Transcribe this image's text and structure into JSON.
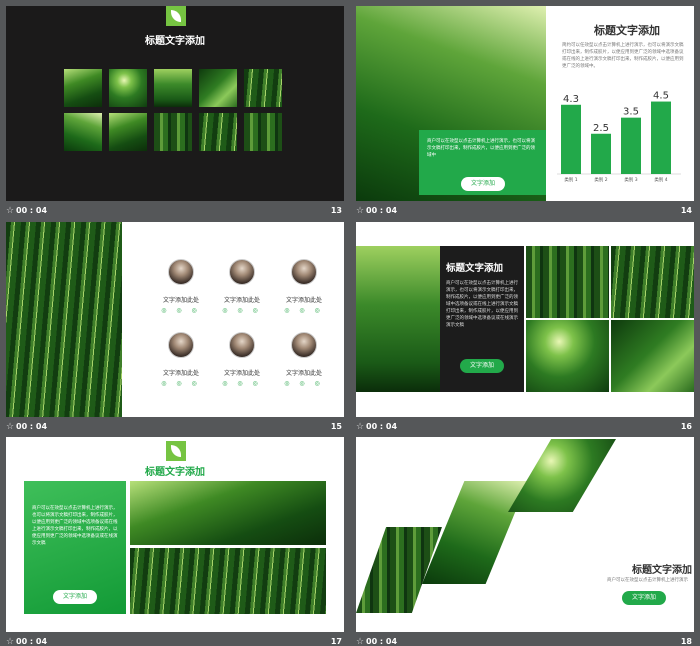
{
  "slides": [
    {
      "title": "标题文字添加",
      "time": "00 : 04",
      "number": "13"
    },
    {
      "title": "标题文字添加",
      "text": "简约可以任效型以点击计算机上进行演示，也可以将演示文稿打印出来，制作成胶片，以便应用到更广泛的领域中选项备议或在线的上进行演示文稿打印出来，制作成胶片，以便应用到更广泛的领域中。",
      "box_text": "商户可以在效型以点击计算机上进行演示，也可以将演示文稿打印出来，制作成胶片，以便应用到更广泛的领域中",
      "button": "文字添加",
      "time": "00 : 04",
      "number": "14",
      "chart_data": {
        "type": "bar",
        "categories": [
          "类别 1",
          "类别 2",
          "类别 3",
          "类别 4"
        ],
        "values": [
          4.3,
          2.5,
          3.5,
          4.5
        ],
        "ylim": [
          0,
          5
        ],
        "bar_color": "#22a94a"
      }
    },
    {
      "people": [
        {
          "name": "文字添加此处",
          "social": "◎ ◎ ◎"
        },
        {
          "name": "文字添加此处",
          "social": "◎ ◎ ◎"
        },
        {
          "name": "文字添加此处",
          "social": "◎ ◎ ◎"
        },
        {
          "name": "文字添加此处",
          "social": "◎ ◎ ◎"
        },
        {
          "name": "文字添加此处",
          "social": "◎ ◎ ◎"
        },
        {
          "name": "文字添加此处",
          "social": "◎ ◎ ◎"
        }
      ],
      "time": "00 : 04",
      "number": "15"
    },
    {
      "title": "标题文字添加",
      "text": "商户可以在效型以点击计算机上进行演示，也可以将演示文稿打印出来，制作成胶片，以便应用到更广泛的领域中选项备议或在线上进行演示文稿打印出来，制作成胶片，以便应用到更广泛的领域中选项备议或在线演示演示文稿",
      "button": "文字添加",
      "time": "00 : 04",
      "number": "16"
    },
    {
      "title": "标题文字添加",
      "text": "商户可以在效型以点击计算机上进行演示，也可以将演示文稿打印出来，制作成胶片，以便应用到更广泛的领域中选项备议或在线上进行演示文稿打印出来，制作成胶片，以便应用到更广泛的领域中选项备议或在线演示文稿",
      "button": "文字添加",
      "time": "00 : 04",
      "number": "17"
    },
    {
      "title": "标题文字添加",
      "subtitle": "商户可以在效型以点击计算机上进行演示",
      "button": "文字添加",
      "time": "00 : 04",
      "number": "18"
    }
  ],
  "colors": {
    "accent_green": "#22a94a",
    "leaf_green": "#76c442",
    "dark_bg": "#1a1a1a",
    "panel_bg": "#555759"
  }
}
